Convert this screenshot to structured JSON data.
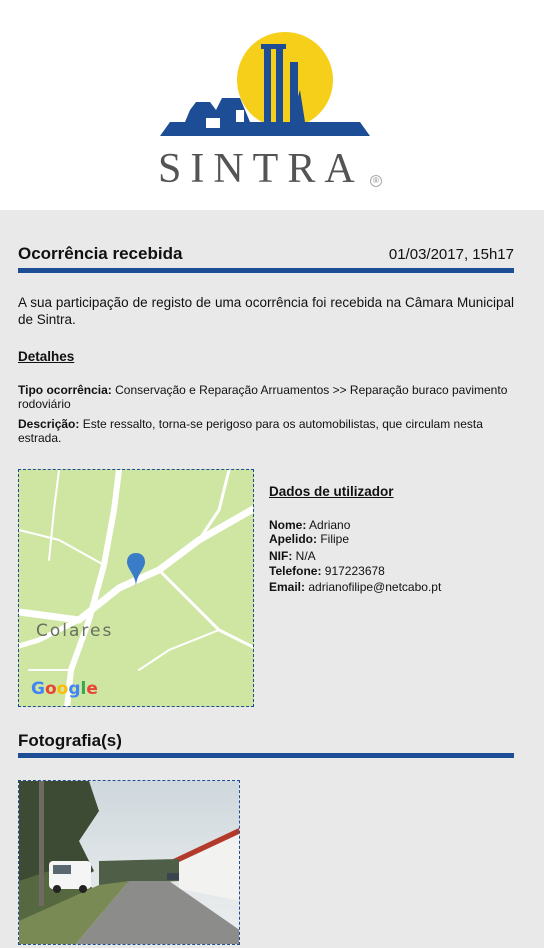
{
  "header": {
    "logo_text": "SINTRA",
    "logo_mark": "®",
    "colors": {
      "blue": "#1d4d95",
      "sun": "#f6cf1a",
      "gray_text": "#545454"
    }
  },
  "report": {
    "title": "Ocorrência recebida",
    "date": "01/03/2017, 15h17",
    "intro": "A sua participação de registo de uma ocorrência foi recebida na Câmara Municipal de Sintra."
  },
  "details": {
    "title": "Detalhes",
    "type_label": "Tipo ocorrência:",
    "type_value": " Conservação e Reparação Arruamentos >> Reparação buraco pavimento rodoviário",
    "desc_label": "Descrição:",
    "desc_value": " Este ressalto, torna-se perigoso para os automobilistas, que circulam nesta estrada."
  },
  "map": {
    "place_label": "Colares",
    "google": [
      "G",
      "o",
      "o",
      "g",
      "l",
      "e"
    ],
    "google_colors": [
      "#4285f4",
      "#ea4335",
      "#fbbc05",
      "#4285f4",
      "#34a853",
      "#ea4335"
    ],
    "pin_icon": "map-pin-icon"
  },
  "user": {
    "title": "Dados de utilizador",
    "fields": [
      {
        "label": "Nome:",
        "value": " Adriano"
      },
      {
        "label": "Apelido:",
        "value": " Filipe"
      },
      {
        "label": "NIF:",
        "value": " N/A"
      },
      {
        "label": "Telefone:",
        "value": " 917223678"
      },
      {
        "label": "Email:",
        "value": " adrianofilipe@netcabo.pt"
      }
    ]
  },
  "photos": {
    "title": "Fotografia(s)"
  }
}
